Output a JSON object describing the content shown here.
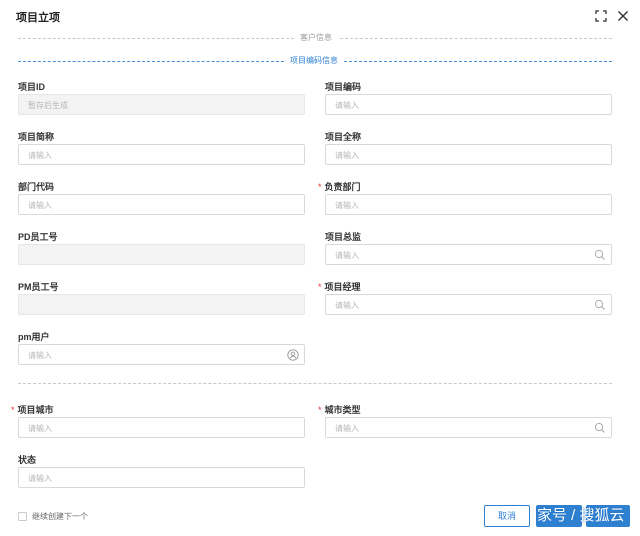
{
  "dialog": {
    "title": "项目立项",
    "fullscreen_icon": "fullscreen-icon",
    "close_icon": "close-icon"
  },
  "sections": {
    "customer_info": "客户信息",
    "project_code_info": "项目编码信息"
  },
  "fields": {
    "project_id": {
      "label": "项目ID",
      "placeholder": "暂存后生成",
      "required": false
    },
    "project_code": {
      "label": "项目编码",
      "placeholder": "请输入",
      "required": false
    },
    "project_short_name": {
      "label": "项目简称",
      "placeholder": "请输入",
      "required": false
    },
    "project_full_name": {
      "label": "项目全称",
      "placeholder": "请输入",
      "required": false
    },
    "dept_code": {
      "label": "部门代码",
      "placeholder": "请输入",
      "required": false
    },
    "responsible_dept": {
      "label": "负责部门",
      "placeholder": "请输入",
      "required": true
    },
    "pd_employee_no": {
      "label": "PD员工号",
      "placeholder": "",
      "required": false
    },
    "project_director": {
      "label": "项目总监",
      "placeholder": "请输入",
      "required": false,
      "suffix_icon": "search-icon"
    },
    "pm_employee_no": {
      "label": "PM员工号",
      "placeholder": "",
      "required": false
    },
    "project_manager": {
      "label": "项目经理",
      "placeholder": "请输入",
      "required": true,
      "suffix_icon": "search-icon"
    },
    "pm_user": {
      "label": "pm用户",
      "placeholder": "请输入",
      "required": false,
      "suffix_icon": "user-icon"
    },
    "project_city": {
      "label": "项目城市",
      "placeholder": "请输入",
      "required": true
    },
    "city_type": {
      "label": "城市类型",
      "placeholder": "请输入",
      "required": true,
      "suffix_icon": "search-icon"
    },
    "status": {
      "label": "状态",
      "placeholder": "请输入",
      "required": false
    }
  },
  "required_marker": "*",
  "footer": {
    "continue_checkbox_label": "继续创建下一个",
    "cancel_button": "取消",
    "watermark": "家号 / 搜狐云"
  },
  "colors": {
    "accent": "#2f80d1",
    "required": "#e53935",
    "border": "#d9d9d9",
    "disabled_bg": "#f3f3f3"
  }
}
